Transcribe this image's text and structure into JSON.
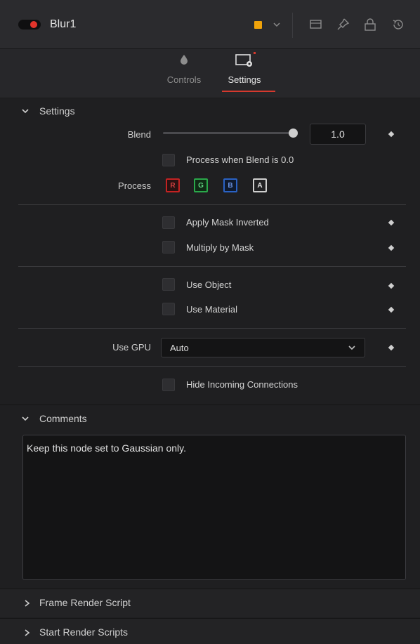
{
  "header": {
    "node_name": "Blur1",
    "node_color": "#f0a30a",
    "icons": [
      "view-icon",
      "pin-icon",
      "lock-icon",
      "reset-icon"
    ]
  },
  "tabs": [
    {
      "label": "Controls",
      "icon": "drop-icon",
      "active": false
    },
    {
      "label": "Settings",
      "icon": "settings-tab-icon",
      "active": true
    }
  ],
  "settings_section": {
    "title": "Settings",
    "blend": {
      "label": "Blend",
      "value": "1.0",
      "fraction": 1.0
    },
    "process_when_blend_zero": "Process when Blend is 0.0",
    "process": {
      "label": "Process",
      "channels": [
        "R",
        "G",
        "B",
        "A"
      ]
    },
    "apply_mask_inverted": "Apply Mask Inverted",
    "multiply_by_mask": "Multiply by Mask",
    "use_object": "Use Object",
    "use_material": "Use Material",
    "use_gpu": {
      "label": "Use GPU",
      "value": "Auto"
    },
    "hide_incoming": "Hide Incoming Connections"
  },
  "comments_section": {
    "title": "Comments",
    "text": "Keep this node set to Gaussian only."
  },
  "frame_render_script": {
    "title": "Frame Render Script"
  },
  "start_render_scripts": {
    "title": "Start Render Scripts"
  },
  "colors": {
    "accent_red": "#d6392e",
    "channel_r": "#c42222",
    "channel_g": "#2aa84a",
    "channel_b": "#2a62c4"
  }
}
